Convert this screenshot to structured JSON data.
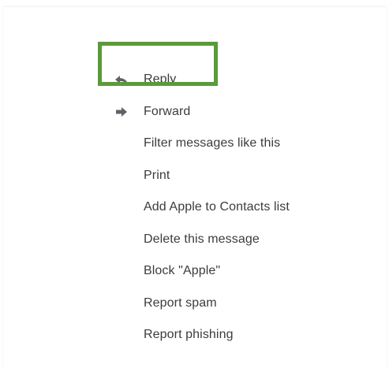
{
  "menu": {
    "items": [
      {
        "label": "Reply",
        "icon": "reply-icon"
      },
      {
        "label": "Forward",
        "icon": "forward-icon"
      },
      {
        "label": "Filter messages like this",
        "icon": ""
      },
      {
        "label": "Print",
        "icon": ""
      },
      {
        "label": "Add Apple to Contacts list",
        "icon": ""
      },
      {
        "label": "Delete this message",
        "icon": ""
      },
      {
        "label": "Block \"Apple\"",
        "icon": ""
      },
      {
        "label": "Report spam",
        "icon": ""
      },
      {
        "label": "Report phishing",
        "icon": ""
      }
    ]
  },
  "colors": {
    "highlight": "#5a9a3a",
    "text": "#3c3c3c",
    "icon": "#5f6368"
  }
}
